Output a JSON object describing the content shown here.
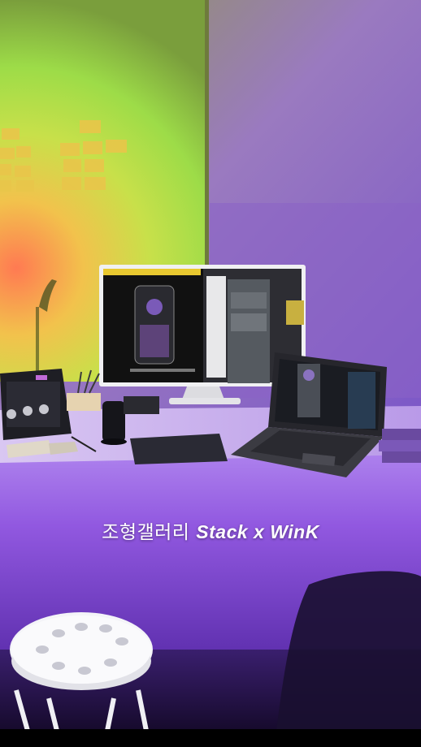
{
  "caption": {
    "korean": "조형갤러리",
    "english": "Stack x WinK"
  },
  "colors": {
    "wall_green": "#b6d640",
    "wall_purple": "#8b57d8",
    "tablecloth": "#9b63e8",
    "caption_text": "#ffffff"
  }
}
